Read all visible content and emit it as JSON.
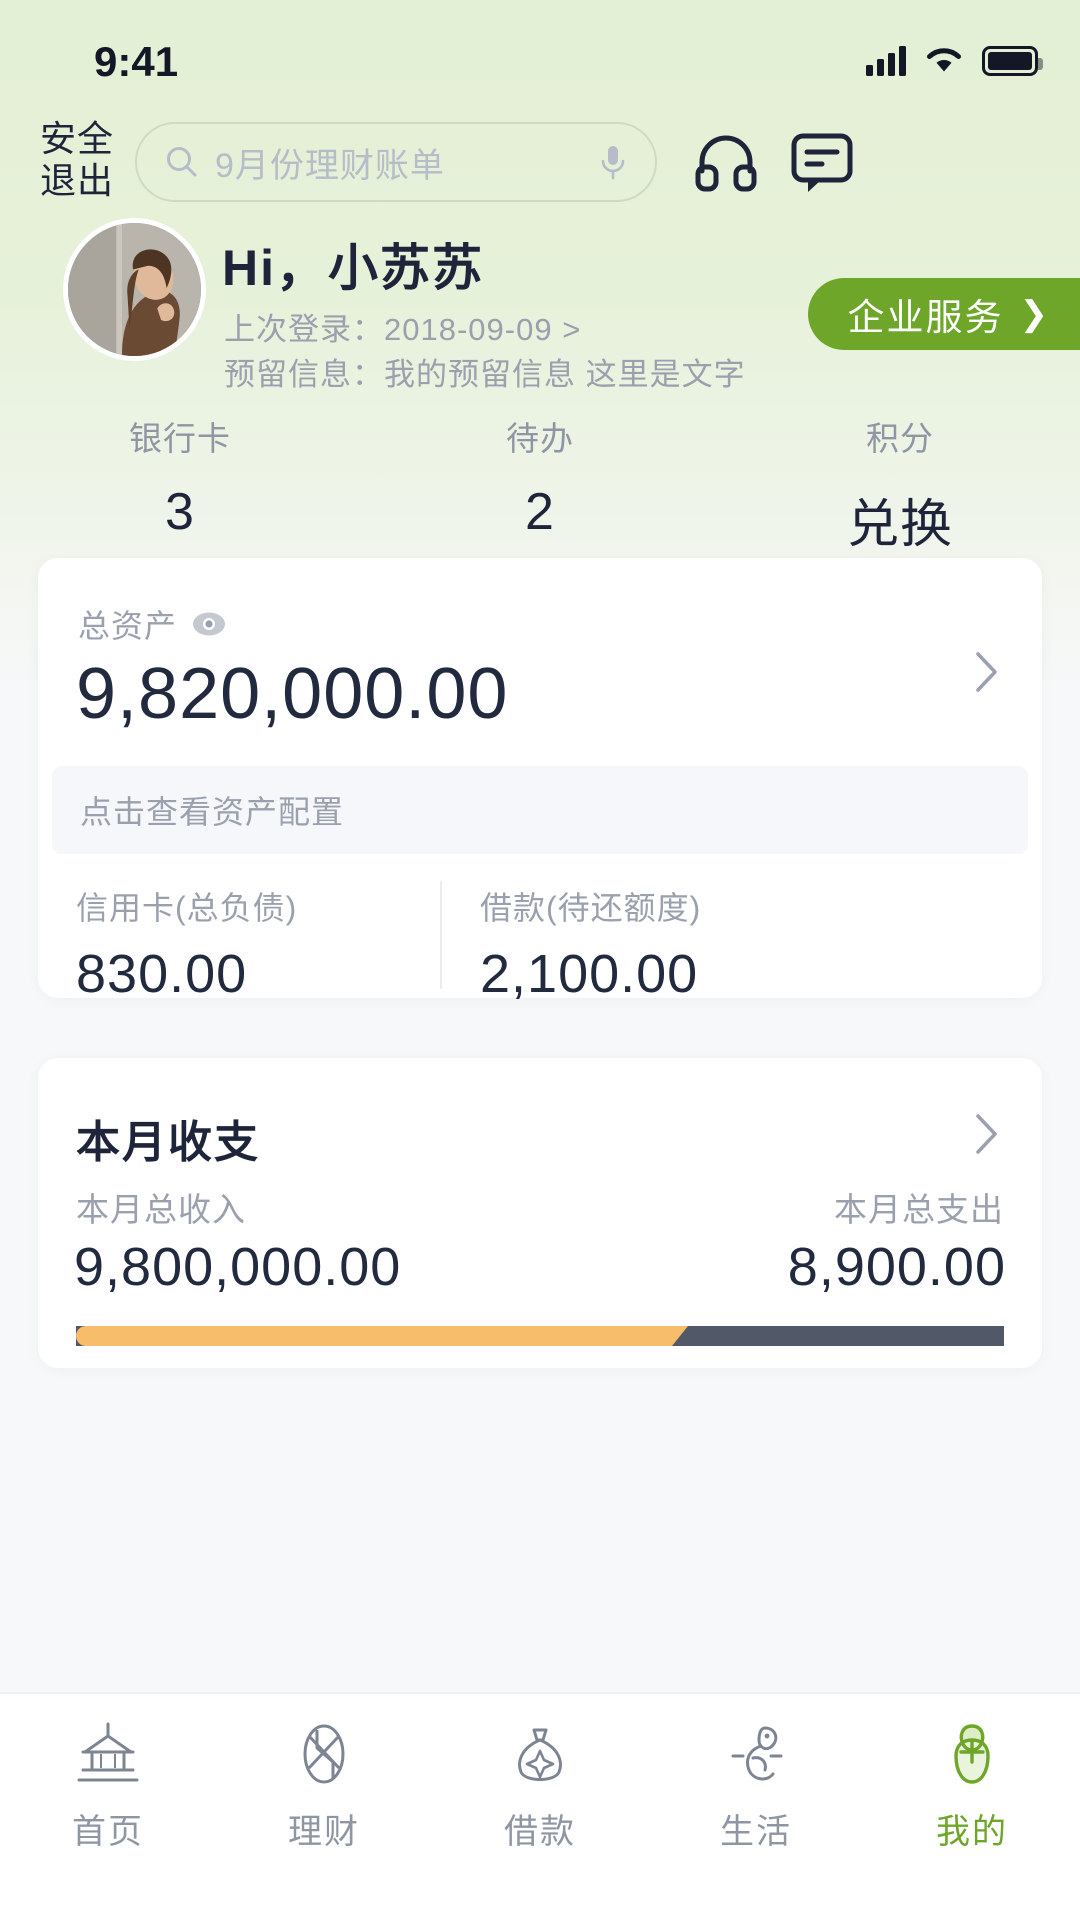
{
  "status_bar": {
    "time": "9:41",
    "icons": [
      "signal-icon",
      "wifi-icon",
      "battery-icon"
    ]
  },
  "header": {
    "logout_label": "安全\n退出",
    "logout_line1": "安全",
    "logout_line2": "退出",
    "search": {
      "placeholder": "9月份理财账单",
      "search_icon": "search-icon",
      "mic_icon": "microphone-icon"
    },
    "headset_icon": "headset-icon",
    "chat_icon": "chat-bubble-icon"
  },
  "profile": {
    "greeting": "Hi，小苏苏",
    "last_login_label": "上次登录：",
    "last_login_value": "2018-09-09",
    "last_login_chevron": ">",
    "reserved_label": "预留信息：",
    "reserved_value": "我的预留信息 这里是文字",
    "enterprise_button": "企业服务",
    "enterprise_chevron": "❯",
    "avatar_icon": "user-avatar"
  },
  "stats": [
    {
      "label": "银行卡",
      "value": "3"
    },
    {
      "label": "待办",
      "value": "2"
    },
    {
      "label": "积分",
      "value": "兑换"
    }
  ],
  "assets_card": {
    "total_label": "总资产",
    "eye_icon": "eye-icon",
    "total_value": "9,820,000.00",
    "chevron_icon": "chevron-right-icon",
    "config_banner": "点击查看资产配置",
    "credit_label": "信用卡(总负债)",
    "credit_value": "830.00",
    "loan_label": "借款(待还额度)",
    "loan_value": "2,100.00"
  },
  "flow_card": {
    "title": "本月收支",
    "chevron_icon": "chevron-right-icon",
    "income_label": "本月总收入",
    "income_value": "9,800,000.00",
    "expense_label": "本月总支出",
    "expense_value": "8,900.00",
    "progress_percent": 66,
    "income_color": "#f7bd6b",
    "expense_color": "#515969"
  },
  "tabbar": [
    {
      "label": "首页",
      "icon": "pagoda-icon",
      "active": false
    },
    {
      "label": "理财",
      "icon": "finance-knot-icon",
      "active": false
    },
    {
      "label": "借款",
      "icon": "money-bag-icon",
      "active": false
    },
    {
      "label": "生活",
      "icon": "bird-icon",
      "active": false
    },
    {
      "label": "我的",
      "icon": "profile-leaf-icon",
      "active": true
    }
  ],
  "colors": {
    "brand_green": "#6ea62a",
    "hero_bg": "#e5f0d7",
    "text_dark": "#1e2439",
    "text_muted": "#9aa0ad",
    "card_bg": "#ffffff"
  }
}
